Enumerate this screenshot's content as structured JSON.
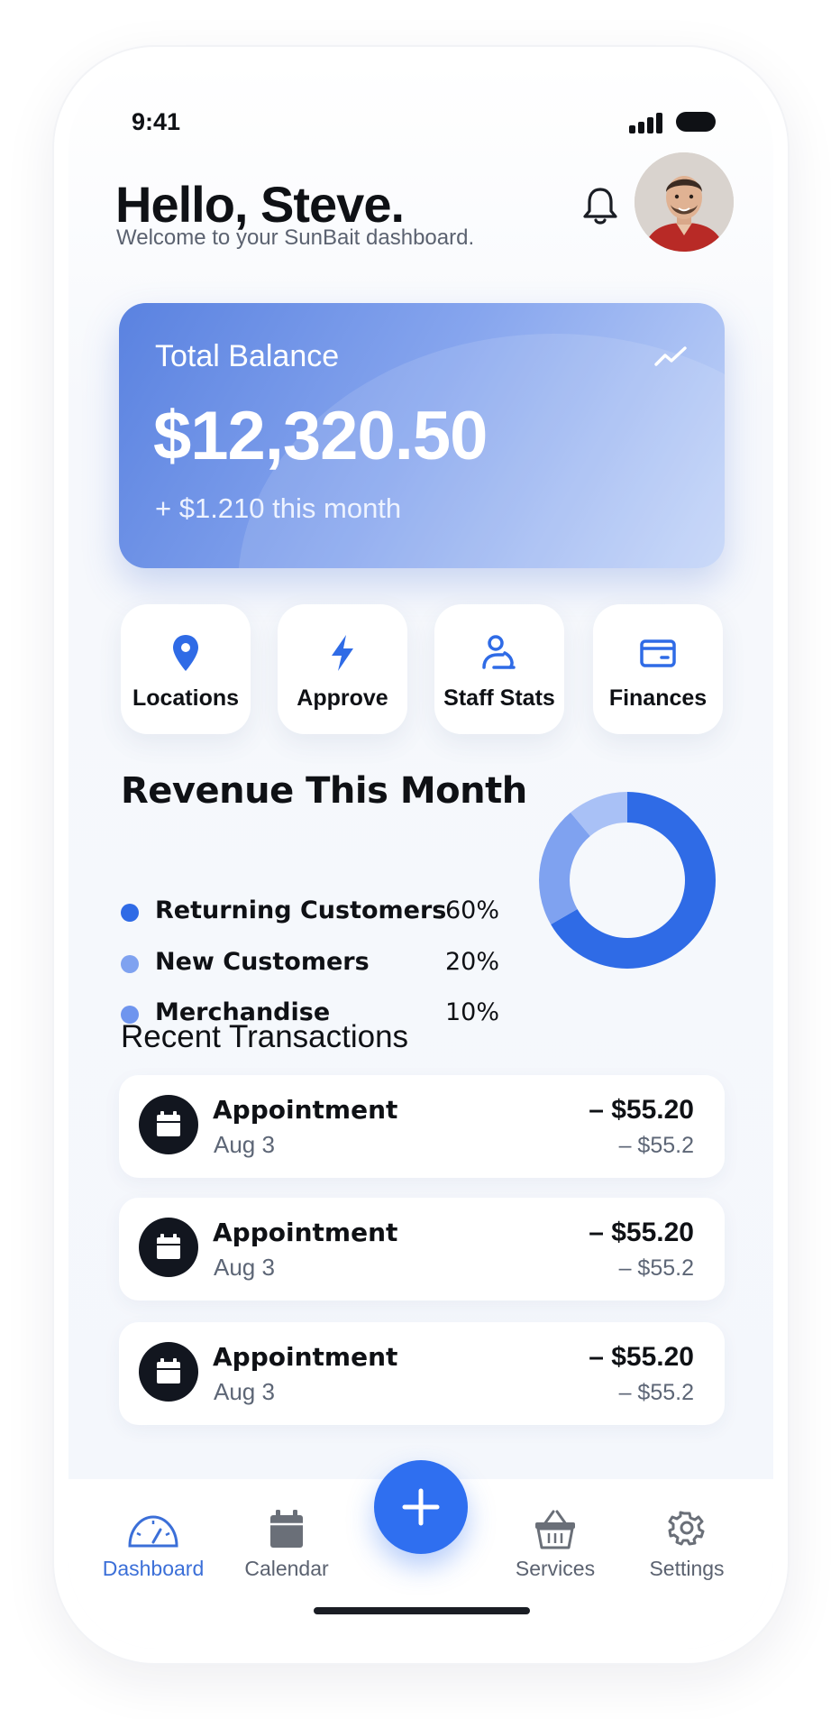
{
  "status_bar": {
    "time": "9:41"
  },
  "header": {
    "greeting": "Hello, Steve.",
    "subtitle": "Welcome to your SunBait dashboard."
  },
  "balance": {
    "label": "Total Balance",
    "amount": "$12,320.50",
    "change": "+ $1.210 this month"
  },
  "quick_actions": [
    {
      "label": "Locations",
      "icon": "map-pin-icon"
    },
    {
      "label": "Approve",
      "icon": "lightning-icon"
    },
    {
      "label": "Staff Stats",
      "icon": "staff-icon"
    },
    {
      "label": "Finances",
      "icon": "wallet-icon"
    }
  ],
  "revenue": {
    "title": "Revenue This Month",
    "items": [
      {
        "label": "Returning Customers",
        "pct": "60%",
        "color": "#2f6be6"
      },
      {
        "label": "New Customers",
        "pct": "20%",
        "color": "#7fa2f0"
      },
      {
        "label": "Merchandise",
        "pct": "10%",
        "color": "#6f95ee"
      }
    ]
  },
  "chart_data": {
    "type": "pie",
    "categories": [
      "Returning Customers",
      "New Customers",
      "Merchandise"
    ],
    "values": [
      60,
      20,
      10
    ],
    "colors": [
      "#2f6be6",
      "#7fa2f0",
      "#a9c1f6"
    ]
  },
  "transactions": {
    "title": "Recent Transactions",
    "items": [
      {
        "name": "Appointment",
        "date": "Aug 3",
        "amount": "– $55.20",
        "sub": "– $55.2"
      },
      {
        "name": "Appointment",
        "date": "Aug 3",
        "amount": "– $55.20",
        "sub": "– $55.2"
      },
      {
        "name": "Appointment",
        "date": "Aug 3",
        "amount": "– $55.20",
        "sub": "– $55.2"
      }
    ]
  },
  "nav": {
    "items": [
      {
        "label": "Dashboard",
        "icon": "speedometer-icon",
        "active": true
      },
      {
        "label": "Calendar",
        "icon": "calendar-icon"
      },
      {
        "label": "Services",
        "icon": "basket-icon"
      },
      {
        "label": "Settings",
        "icon": "gear-icon"
      }
    ],
    "fab_icon": "plus-icon"
  },
  "colors": {
    "accent": "#2f6ff0",
    "text": "#0f1115",
    "muted": "#5b6270"
  }
}
